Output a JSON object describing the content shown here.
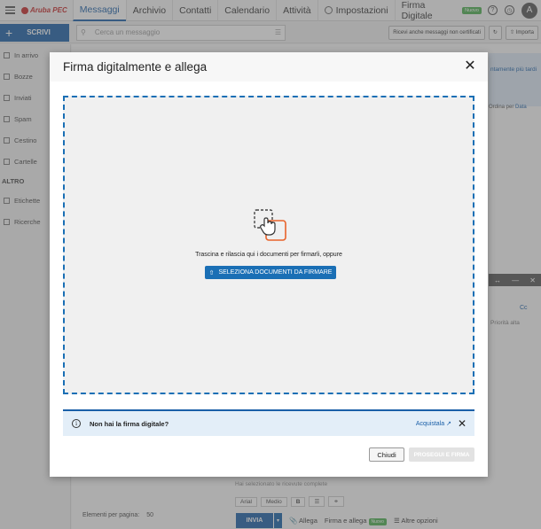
{
  "app": {
    "logo_text": "Aruba PEC",
    "avatar_letter": "A"
  },
  "nav": {
    "tabs": [
      {
        "label": "Messaggi"
      },
      {
        "label": "Archivio"
      },
      {
        "label": "Contatti"
      },
      {
        "label": "Calendario"
      },
      {
        "label": "Attività"
      },
      {
        "label": "Impostazioni"
      },
      {
        "label": "Firma Digitale"
      }
    ],
    "new_badge": "Nuovo"
  },
  "toolbar": {
    "compose_label": "SCRIVI",
    "search_placeholder": "Cerca un messaggio",
    "receive_label": "Ricevi anche messaggi non certificati",
    "import_label": "Importa"
  },
  "sidebar": {
    "items": [
      {
        "label": "In arrivo"
      },
      {
        "label": "Bozze"
      },
      {
        "label": "Inviati"
      },
      {
        "label": "Spam"
      },
      {
        "label": "Cestino"
      },
      {
        "label": "Cartelle"
      }
    ],
    "section_label": "ALTRO",
    "extra_items": [
      {
        "label": "Etichette"
      },
      {
        "label": "Ricerche"
      }
    ]
  },
  "background": {
    "banner_text": "ntamente più tardi",
    "sort_label": "Ordina per",
    "sort_value": "Data",
    "cc_label": "Cc",
    "priority_label": "Priorità alta",
    "selection_note": "Hai selezionato le ricevute complete",
    "font_value": "Arial",
    "size_value": "Medio",
    "send_label": "INVIA",
    "attach_label": "Allega",
    "sign_attach_label": "Firma e allega",
    "other_options_label": "Altre opzioni",
    "per_page_label": "Elementi per pagina:",
    "per_page_value": "50"
  },
  "modal": {
    "title": "Firma digitalmente e allega",
    "drop_text": "Trascina e rilascia qui i documenti per firmarli, oppure",
    "select_button": "SELEZIONA DOCUMENTI DA FIRMARE",
    "info_text": "Non hai la firma digitale?",
    "info_link": "Acquistala",
    "close_button": "Chiudi",
    "proceed_button": "PROSEGUI E FIRMA"
  },
  "colors": {
    "accent": "#1a5fa8",
    "drop_icon_orange": "#e8632b",
    "new_badge": "#4caf50"
  }
}
